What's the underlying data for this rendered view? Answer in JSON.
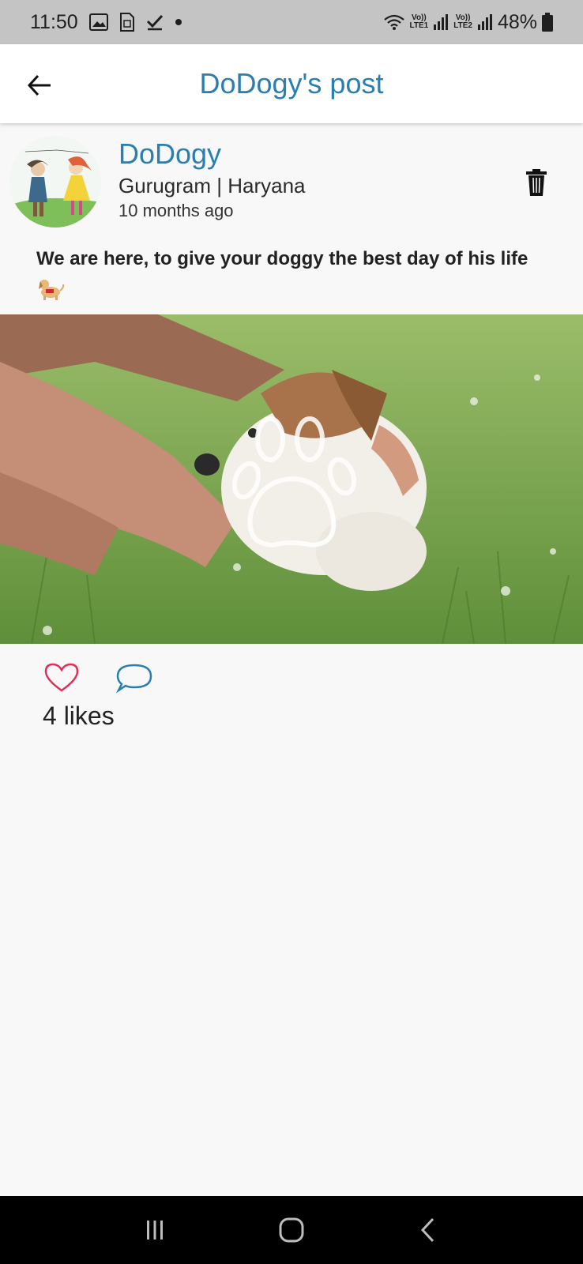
{
  "status_bar": {
    "time": "11:50",
    "battery": "48%",
    "sim1": "LTE1",
    "sim2": "LTE2",
    "volte": "Vo))",
    "icons": [
      "gallery-icon",
      "sim-card-icon",
      "checkmark-icon",
      "dot-icon",
      "wifi-icon",
      "signal-icon",
      "signal-icon",
      "battery-icon"
    ]
  },
  "app_bar": {
    "title": "DoDogy's post"
  },
  "post": {
    "username": "DoDogy",
    "location": "Gurugram | Haryana",
    "timestamp": "10 months ago",
    "caption": "We are here, to give your doggy the best day of his life",
    "likes": "4 likes"
  },
  "colors": {
    "accent": "#2a7fb0",
    "like": "#e0305a",
    "comment": "#2a7fb0"
  }
}
